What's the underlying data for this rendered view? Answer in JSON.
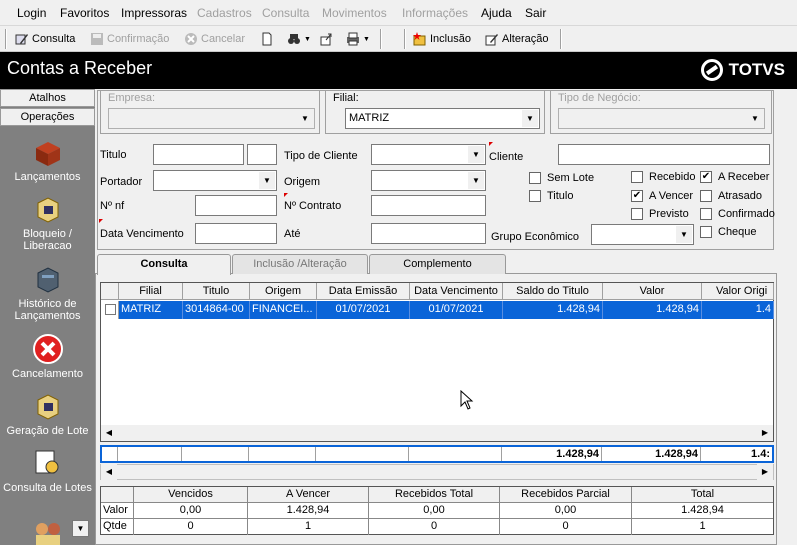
{
  "menu": [
    "Login",
    "Favoritos",
    "Impressoras",
    "Cadastros",
    "Consulta",
    "Movimentos",
    "Informações",
    "Ajuda",
    "Sair"
  ],
  "toolbar": {
    "consulta": "Consulta",
    "confirmacao": "Confirmação",
    "cancelar": "Cancelar",
    "inclusao": "Inclusão",
    "alteracao": "Alteração"
  },
  "window": {
    "title": "Contas a Receber",
    "logo": "TOTVS"
  },
  "sidebar": {
    "atalhos": "Atalhos",
    "operacoes": "Operações",
    "items": [
      "Lançamentos",
      "Bloqueio / Liberacao",
      "Histórico de Lançamentos",
      "Cancelamento",
      "Geração de Lote",
      "Consulta de Lotes"
    ]
  },
  "filters": {
    "empresa_label": "Empresa:",
    "empresa_value": "",
    "filial_label": "Filial:",
    "filial_value": "MATRIZ",
    "tipo_negocio_label": "Tipo de Negócio:",
    "tipo_negocio_value": "",
    "titulo_label": "Titulo",
    "tipo_cliente_label": "Tipo de Cliente",
    "cliente_label": "Cliente",
    "portador_label": "Portador",
    "origem_label": "Origem",
    "nnf_label": "Nº nf",
    "ncontrato_label": "Nº Contrato",
    "data_venc_label": "Data Vencimento",
    "ate_label": "Até",
    "grupo_label": "Grupo Econômico"
  },
  "checks": {
    "sem_lote": {
      "label": "Sem Lote",
      "checked": false
    },
    "titulo": {
      "label": "Titulo",
      "checked": false
    },
    "recebido": {
      "label": "Recebido",
      "checked": false
    },
    "a_vencer": {
      "label": "A Vencer",
      "checked": true
    },
    "previsto": {
      "label": "Previsto",
      "checked": false
    },
    "a_receber": {
      "label": "A Receber",
      "checked": true
    },
    "atrasado": {
      "label": "Atrasado",
      "checked": false
    },
    "confirmado": {
      "label": "Confirmado",
      "checked": false
    },
    "cheque": {
      "label": "Cheque",
      "checked": false
    }
  },
  "tabs": [
    "Consulta",
    "Inclusão /Alteração",
    "Complemento"
  ],
  "grid": {
    "headers": [
      "Filial",
      "Titulo",
      "Origem",
      "Data Emissão",
      "Data Vencimento",
      "Saldo do Titulo",
      "Valor",
      "Valor Origi"
    ],
    "row": [
      "MATRIZ",
      "3014864-00",
      "FINANCEI...",
      "01/07/2021",
      "01/07/2021",
      "1.428,94",
      "1.428,94",
      "1.4"
    ]
  },
  "totals": [
    "1.428,94",
    "1.428,94",
    "1.4:"
  ],
  "summary": {
    "headers": [
      "Vencidos",
      "A Vencer",
      "Recebidos Total",
      "Recebidos Parcial",
      "Total"
    ],
    "valor_label": "Valor",
    "qtde_label": "Qtde",
    "valor": [
      "0,00",
      "1.428,94",
      "0,00",
      "0,00",
      "1.428,94"
    ],
    "qtde": [
      "0",
      "1",
      "0",
      "0",
      "1"
    ]
  }
}
